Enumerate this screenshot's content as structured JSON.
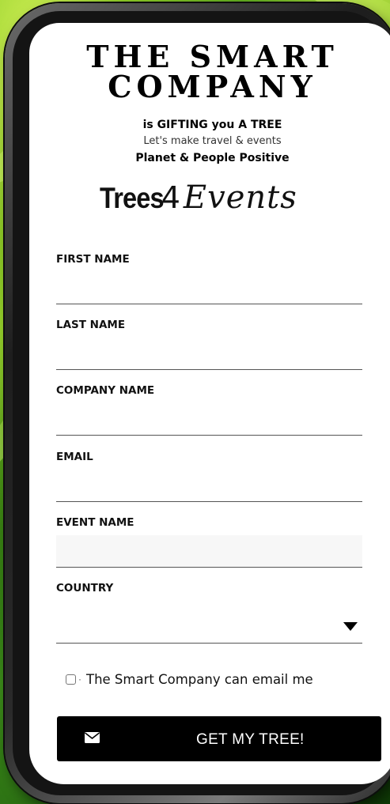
{
  "brand": {
    "line1": "THE SMART",
    "line2": "COMPANY"
  },
  "tagline": {
    "line1": "is GIFTING you A TREE",
    "line2": "Let's make travel & events",
    "line3": "Planet & People Positive"
  },
  "logo": {
    "trees": "Trees",
    "four": "4",
    "events": "Events"
  },
  "form": {
    "first_name_label": "FIRST NAME",
    "first_name_value": "",
    "last_name_label": "LAST NAME",
    "last_name_value": "",
    "company_label": "COMPANY NAME",
    "company_value": "",
    "email_label": "EMAIL",
    "email_value": "",
    "event_label": "EVENT NAME",
    "event_value": "",
    "country_label": "COUNTRY",
    "country_value": "",
    "consent_text": "The Smart Company can email me",
    "consent_checked": false,
    "submit_label": "GET MY TREE!"
  },
  "icons": {
    "submit": "envelope-icon",
    "country_select": "caret-down-icon"
  },
  "colors": {
    "button_bg": "#000000",
    "button_text": "#ffffff"
  }
}
